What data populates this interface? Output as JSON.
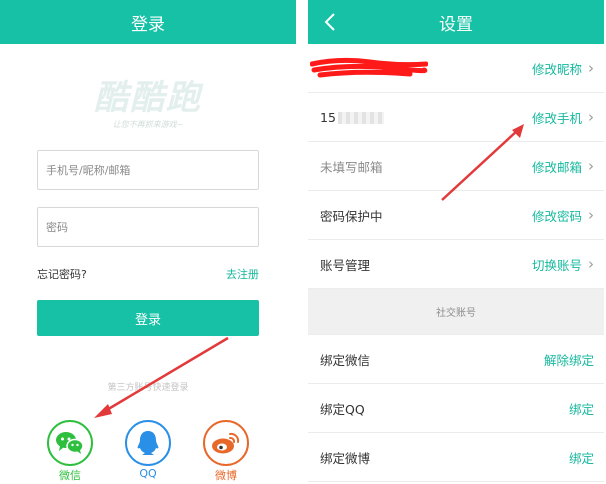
{
  "login": {
    "title": "登录",
    "logo": "酷酷跑",
    "slogan": "让您不再抓来游戏~",
    "account_placeholder": "手机号/昵称/邮箱",
    "password_placeholder": "密码",
    "forgot": "忘记密码?",
    "register": "去注册",
    "login_button": "登录",
    "third_party": "第三方账号快速登录",
    "social": [
      {
        "label": "微信",
        "icon": "wechat-icon",
        "color": "#2fbf3e"
      },
      {
        "label": "QQ",
        "icon": "qq-icon",
        "color": "#2a8fe6"
      },
      {
        "label": "微博",
        "icon": "weibo-icon",
        "color": "#e8682a"
      }
    ]
  },
  "settings": {
    "title": "设置",
    "rows": [
      {
        "label": "",
        "action": "修改昵称"
      },
      {
        "label": "15",
        "action": "修改手机"
      },
      {
        "label": "未填写邮箱",
        "action": "修改邮箱"
      },
      {
        "label": "密码保护中",
        "action": "修改密码"
      },
      {
        "label": "账号管理",
        "action": "切换账号"
      }
    ],
    "section": "社交账号",
    "social_rows": [
      {
        "label": "绑定微信",
        "action": "解除绑定"
      },
      {
        "label": "绑定QQ",
        "action": "绑定"
      },
      {
        "label": "绑定微博",
        "action": "绑定"
      }
    ]
  },
  "colors": {
    "accent": "#16c1a6",
    "annotation": "#e23a3a"
  }
}
